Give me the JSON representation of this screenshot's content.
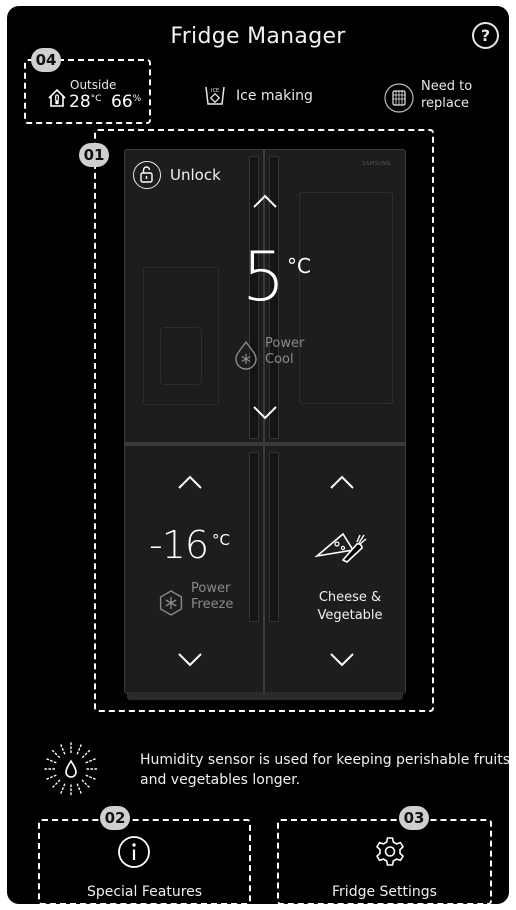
{
  "app": {
    "title": "Fridge Manager",
    "help_label": "?"
  },
  "outside": {
    "label": "Outside",
    "temperature": "28",
    "temp_unit": "°C",
    "humidity": "66",
    "humidity_unit": "%"
  },
  "ice": {
    "label": "Ice making"
  },
  "filter": {
    "line1": "Need to",
    "line2": "replace"
  },
  "badges": {
    "b01": "01",
    "b02": "02",
    "b03": "03",
    "b04": "04"
  },
  "fridge": {
    "brand": "SAMSUNG",
    "unlock_label": "Unlock",
    "fridge_temp": "5",
    "fridge_unit": "°C",
    "power_cool_line1": "Power",
    "power_cool_line2": "Cool",
    "freezer_temp": "-16",
    "freezer_unit": "°C",
    "power_freeze_line1": "Power",
    "power_freeze_line2": "Freeze",
    "drawer_line1": "Cheese &",
    "drawer_line2": "Vegetable"
  },
  "humidity": {
    "text": "Humidity sensor is used for keeping perishable fruits and vegetables longer."
  },
  "bottom": {
    "special_label": "Special Features",
    "settings_label": "Fridge Settings"
  },
  "icons": [
    "help-icon",
    "house-thermometer-icon",
    "ice-icon",
    "filter-icon",
    "unlock-icon",
    "chevron-up-icon",
    "chevron-down-icon",
    "snowflake-drop-icon",
    "snowflake-hex-icon",
    "vegetable-icon",
    "humidity-drop-icon",
    "info-icon",
    "gear-icon"
  ]
}
